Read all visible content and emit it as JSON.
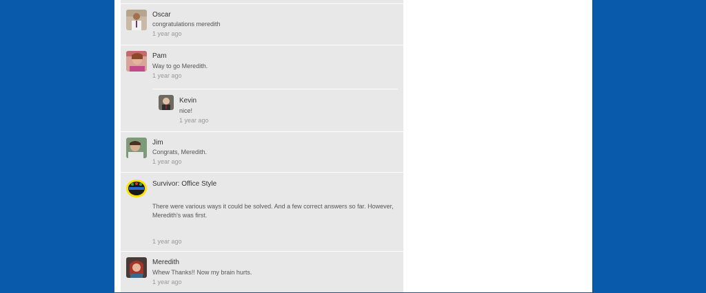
{
  "comments": [
    {
      "author": "Oscar",
      "text": "congratulations meredith",
      "time": "1 year ago",
      "avatar_icon": "oscar-avatar"
    },
    {
      "author": "Pam",
      "text": "Way to go Meredith.",
      "time": "1 year ago",
      "avatar_icon": "pam-avatar"
    },
    {
      "author": "Kevin",
      "text": "nice!",
      "time": "1 year ago",
      "avatar_icon": "kevin-avatar"
    },
    {
      "author": "Jim",
      "text": "Congrats, Meredith.",
      "time": "1 year ago",
      "avatar_icon": "jim-avatar"
    },
    {
      "author": "Survivor: Office Style",
      "text": "There were various ways it could be solved.  And a few correct answers so far.  However, Meredith's was first.",
      "time": "1 year ago",
      "avatar_icon": "survivor-logo"
    },
    {
      "author": "Meredith",
      "text": "Whew Thanks!!  Now my brain hurts.",
      "time": "1 year ago",
      "avatar_icon": "meredith-avatar"
    }
  ],
  "colors": {
    "background": "#0a5aab",
    "page": "#ffffff",
    "feed": "#e8e8e8"
  }
}
